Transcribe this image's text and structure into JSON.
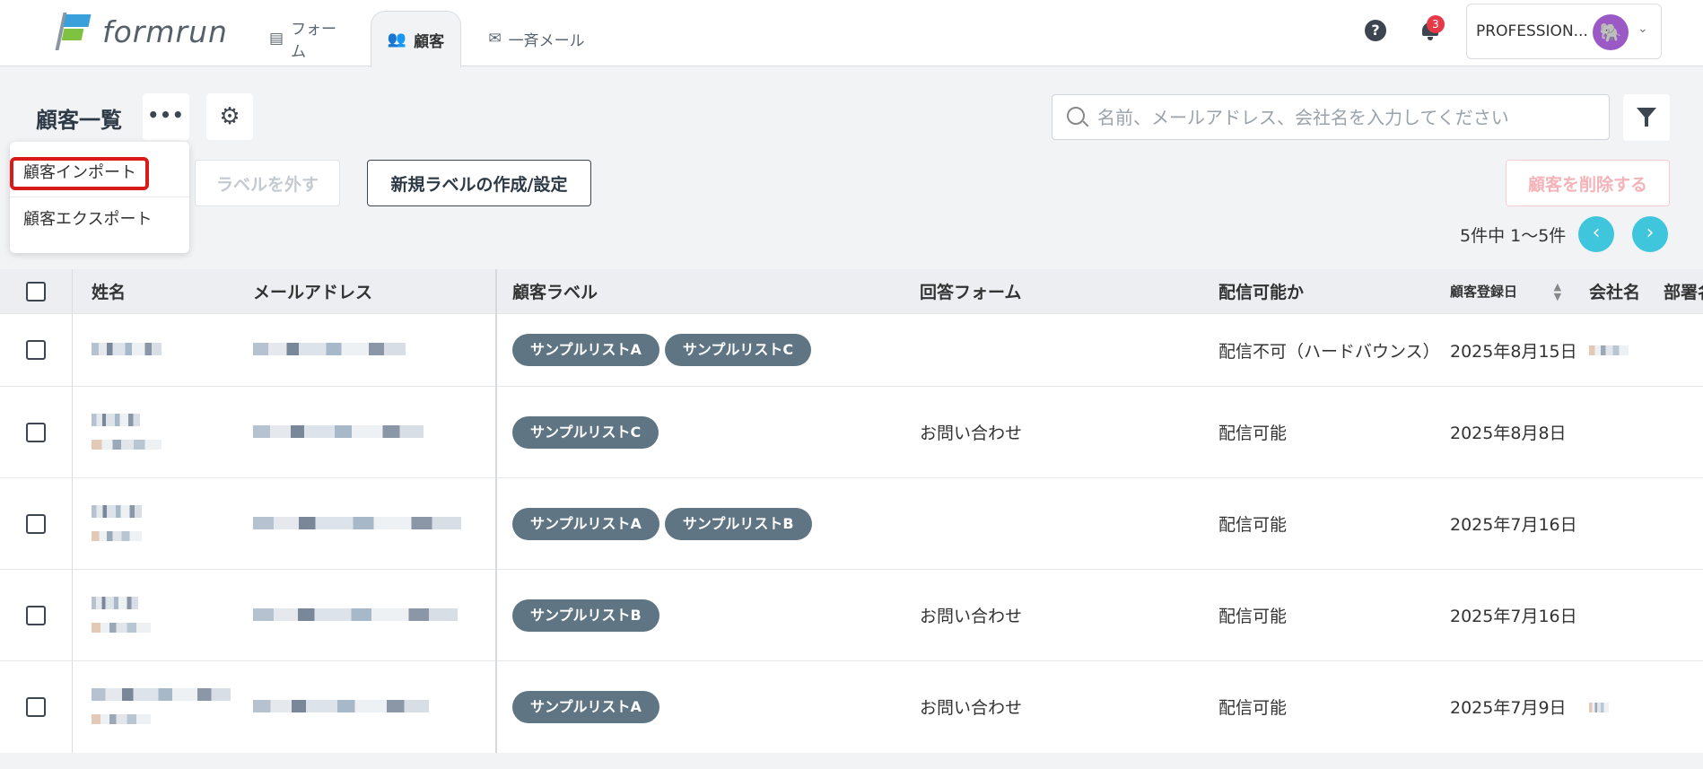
{
  "app": {
    "logo_text": "formrun"
  },
  "nav": {
    "tabs": [
      {
        "label": "フォーム",
        "icon": "form-icon"
      },
      {
        "label": "顧客",
        "icon": "people-icon"
      },
      {
        "label": "一斉メール",
        "icon": "mail-icon"
      }
    ],
    "active_tab": "顧客"
  },
  "header": {
    "help_label": "?",
    "notification_count": "3",
    "account_plan": "PROFESSION...",
    "avatar_icon": "elephant-icon"
  },
  "page": {
    "title": "顧客一覧",
    "more_label": "•••",
    "search_placeholder": "名前、メールアドレス、会社名を入力してください"
  },
  "dropdown": {
    "items": [
      "顧客インポート",
      "顧客エクスポート"
    ],
    "highlighted": "顧客インポート"
  },
  "toolbar": {
    "remove_label": "ラベルを外す",
    "new_label": "新規ラベルの作成/設定",
    "delete_label": "顧客を削除する"
  },
  "pager": {
    "text": "5件中 1～5件",
    "prev": "‹",
    "next": "›"
  },
  "table": {
    "headers": [
      "姓名",
      "メールアドレス",
      "顧客ラベル",
      "回答フォーム",
      "配信可能か",
      "顧客登録日",
      "会社名",
      "部署名"
    ],
    "rows": [
      {
        "labels": [
          "サンプルリストA",
          "サンプルリストC"
        ],
        "form": "",
        "delivery": "配信不可（ハードバウンス）",
        "date": "2025年8月15日"
      },
      {
        "labels": [
          "サンプルリストC"
        ],
        "form": "お問い合わせ",
        "delivery": "配信可能",
        "date": "2025年8月8日"
      },
      {
        "labels": [
          "サンプルリストA",
          "サンプルリストB"
        ],
        "form": "",
        "delivery": "配信可能",
        "date": "2025年7月16日"
      },
      {
        "labels": [
          "サンプルリストB"
        ],
        "form": "お問い合わせ",
        "delivery": "配信可能",
        "date": "2025年7月16日"
      },
      {
        "labels": [
          "サンプルリストA"
        ],
        "form": "お問い合わせ",
        "delivery": "配信可能",
        "date": "2025年7月9日"
      }
    ]
  },
  "colors": {
    "accent": "#3fc5dc",
    "tag": "#5f7584",
    "danger": "#d91a1a"
  }
}
